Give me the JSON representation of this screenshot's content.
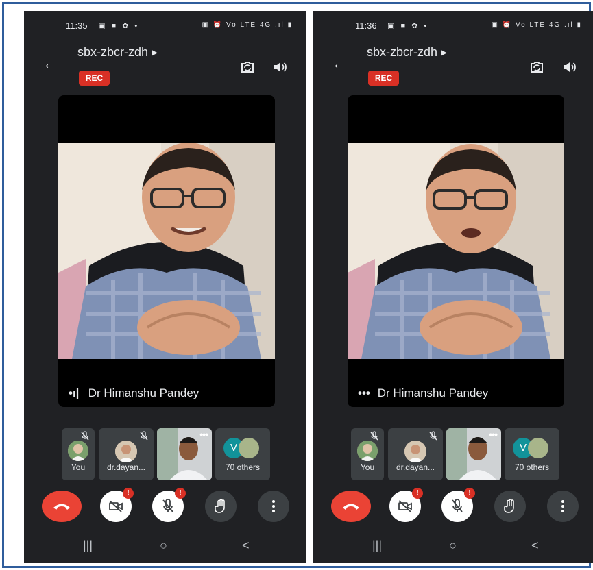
{
  "phones": [
    {
      "status_time": "11:35",
      "status_icons": "▣ ■ ✿ •",
      "right_icons": "▣ ⏰ Vo LTE 4G .ıl ▮",
      "meeting_code": "sbx-zbcr-zdh ▸",
      "rec_label": "REC",
      "speaker_name": "Dr Himanshu Pandey",
      "speaker_indicator": "•ı|",
      "participants": [
        {
          "label": "You"
        },
        {
          "label": "dr.dayan..."
        },
        {
          "label": ""
        },
        {
          "label": "70 others",
          "initial": "V"
        }
      ]
    },
    {
      "status_time": "11:36",
      "status_icons": "▣ ■ ✿ •",
      "right_icons": "▣ ⏰ Vo LTE 4G .ıl ▮",
      "meeting_code": "sbx-zbcr-zdh ▸",
      "rec_label": "REC",
      "speaker_name": "Dr Himanshu Pandey",
      "speaker_indicator": "•••",
      "participants": [
        {
          "label": "You"
        },
        {
          "label": "dr.dayan..."
        },
        {
          "label": ""
        },
        {
          "label": "70 others",
          "initial": "V"
        }
      ]
    }
  ],
  "controls": {
    "badge": "!"
  },
  "nav": {
    "recents": "|||",
    "home": "○",
    "back": "<"
  },
  "colors": {
    "background": "#202124",
    "rec": "#d93025",
    "end_call": "#ea4335",
    "frame_border": "#2f5d9c",
    "avatar_v": "#12939a"
  }
}
